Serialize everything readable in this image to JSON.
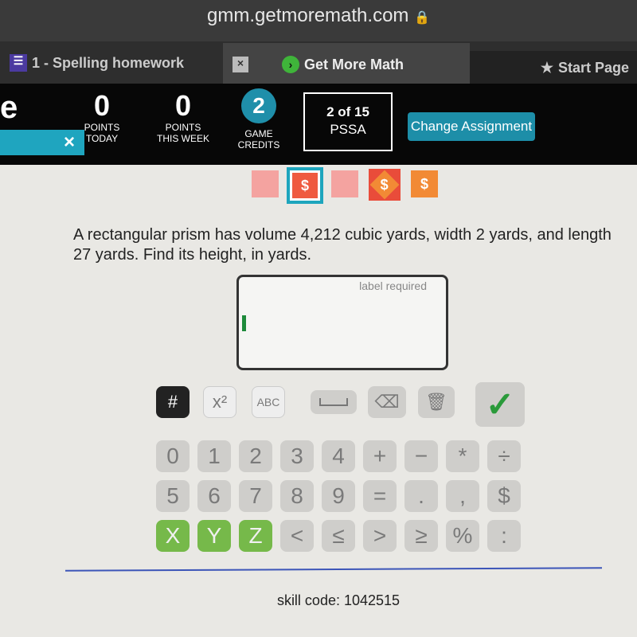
{
  "browser": {
    "url": "gmm.getmoremath.com",
    "tabs": [
      {
        "label": "1 - Spelling homework"
      },
      {
        "label": "Get More Math"
      },
      {
        "label": "Start Page"
      }
    ]
  },
  "header": {
    "points_today": {
      "value": "0",
      "label1": "POINTS",
      "label2": "TODAY"
    },
    "points_week": {
      "value": "0",
      "label1": "POINTS",
      "label2": "THIS WEEK"
    },
    "game_credits": {
      "value": "2",
      "label1": "GAME",
      "label2": "CREDITS"
    },
    "progress": {
      "line1": "2 of 15",
      "line2": "PSSA"
    },
    "change_assignment": "Change Assignment",
    "close": "×"
  },
  "progress_squares": [
    {
      "state": "empty",
      "color": "#f4a3a0",
      "label": ""
    },
    {
      "state": "current",
      "color": "#ef5a40",
      "label": "$"
    },
    {
      "state": "empty",
      "color": "#f4a3a0",
      "label": ""
    },
    {
      "state": "earned",
      "color": "#e94c3a",
      "label": "$"
    },
    {
      "state": "earned",
      "color": "#f28a35",
      "label": "$"
    }
  ],
  "question": {
    "text": "A rectangular prism has volume 4,212 cubic yards, width 2 yards, and length 27 yards. Find its height, in yards.",
    "answer_placeholder": "label required",
    "answer_value": ""
  },
  "keypad": {
    "mode_keys": [
      "#",
      "x²",
      "ABC"
    ],
    "row1": [
      "0",
      "1",
      "2",
      "3",
      "4",
      "+",
      "−",
      "*",
      "÷"
    ],
    "row2": [
      "5",
      "6",
      "7",
      "8",
      "9",
      "=",
      ".",
      ",",
      "$"
    ],
    "row3": [
      "X",
      "Y",
      "Z",
      "<",
      "≤",
      ">",
      "≥",
      "%",
      ":"
    ]
  },
  "footer": {
    "skill_code": "skill code: 1042515"
  }
}
